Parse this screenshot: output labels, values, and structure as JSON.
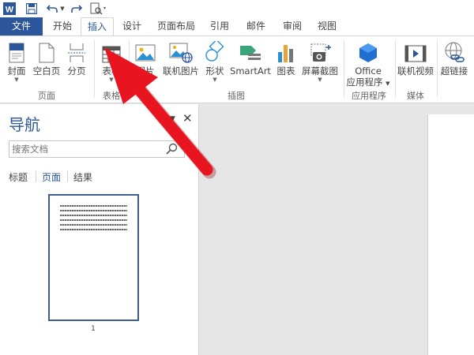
{
  "quick_access": {
    "icons": [
      "word-icon",
      "save-icon",
      "undo-icon",
      "undo-dropdown-icon",
      "redo-icon",
      "print-preview-icon"
    ]
  },
  "tabs": [
    {
      "label": "文件"
    },
    {
      "label": "开始"
    },
    {
      "label": "插入"
    },
    {
      "label": "设计"
    },
    {
      "label": "页面布局"
    },
    {
      "label": "引用"
    },
    {
      "label": "邮件"
    },
    {
      "label": "审阅"
    },
    {
      "label": "视图"
    }
  ],
  "ribbon": {
    "buttons": [
      {
        "label": "封面",
        "icon": "cover-page-icon"
      },
      {
        "label": "空白页",
        "icon": "blank-page-icon"
      },
      {
        "label": "分页",
        "icon": "page-break-icon"
      },
      {
        "label": "表格",
        "icon": "table-icon"
      },
      {
        "label": "图片",
        "icon": "picture-icon"
      },
      {
        "label": "联机图片",
        "icon": "online-picture-icon"
      },
      {
        "label": "形状",
        "icon": "shapes-icon"
      },
      {
        "label": "SmartArt",
        "icon": "smartart-icon"
      },
      {
        "label": "图表",
        "icon": "chart-icon"
      },
      {
        "label": "屏幕截图",
        "icon": "screenshot-icon"
      },
      {
        "label": "Office",
        "label2": "应用程序",
        "icon": "office-apps-icon"
      },
      {
        "label": "联机视频",
        "icon": "online-video-icon"
      },
      {
        "label": "超链接",
        "icon": "hyperlink-icon"
      }
    ],
    "groups": [
      "页面",
      "表格",
      "插图",
      "应用程序",
      "媒体"
    ]
  },
  "navigation": {
    "title": "导航",
    "search_placeholder": "搜索文档",
    "tabs": [
      "标题",
      "页面",
      "结果"
    ],
    "page_number": "1"
  },
  "colors": {
    "accent": "#2b579a",
    "arrow": "#e8141f"
  }
}
